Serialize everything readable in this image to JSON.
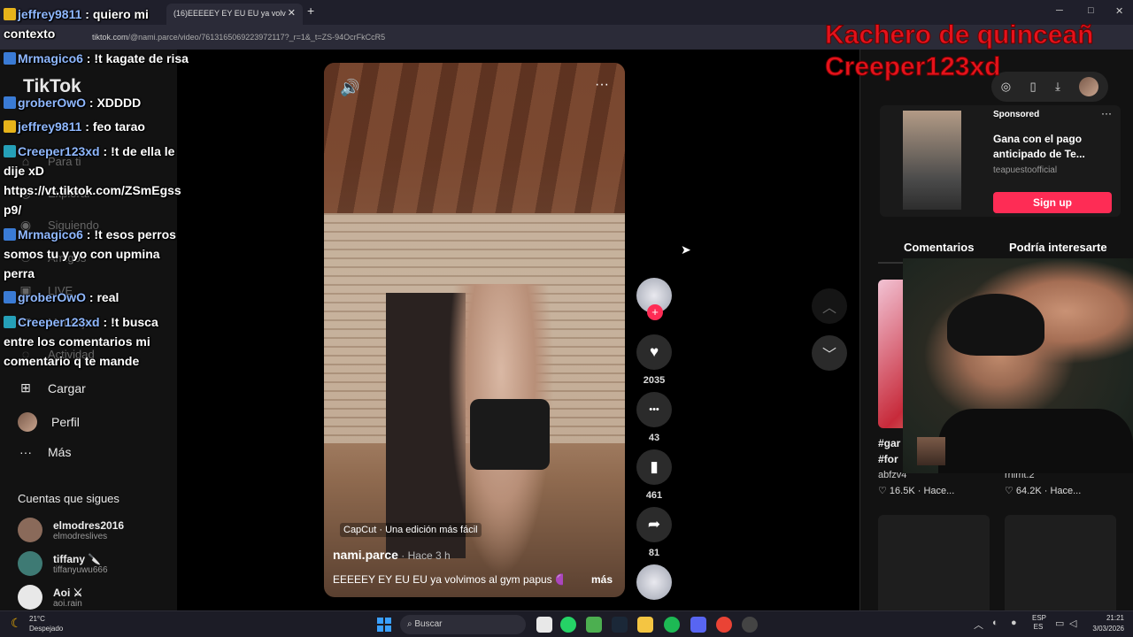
{
  "browser": {
    "tab_title": "(16)EEEEEY EY EU EU ya volv",
    "tab_close": "✕",
    "new_tab": "+",
    "url_host": "tiktok.com",
    "url_path": "/@nami.parce/video/7613165069223972117?_r=1&_t=ZS-94OcrFkCcR5",
    "win_min": "─",
    "win_max": "□",
    "win_close": "✕"
  },
  "overlay": {
    "line1": "Kachero de quinceañ",
    "line2": "Creeper123xd"
  },
  "chat": [
    {
      "user": "jeffrey9811",
      "text": " : quiero mi contexto",
      "badge": "gold"
    },
    {
      "user": "Mrmagico6",
      "text": " : !t kagate de risa",
      "badge": "blue"
    },
    {
      "user": "groberOwO",
      "text": " : XDDDD",
      "badge": "blue"
    },
    {
      "user": "jeffrey9811",
      "text": " : feo tarao",
      "badge": "gold"
    },
    {
      "user": "Creeper123xd",
      "text": " : !t de ella le dije xD https://vt.tiktok.com/ZSmEgss p9/",
      "badge": "teal"
    },
    {
      "user": "Mrmagico6",
      "text": " : !t esos perros somos tu y yo con upmina perra",
      "badge": "blue"
    },
    {
      "user": "groberOwO",
      "text": " : real",
      "badge": "blue"
    },
    {
      "user": "Creeper123xd",
      "text": " : !t busca entre los comentarios mi comentario q te mande",
      "badge": "teal"
    }
  ],
  "sidebar": {
    "logo": "TikTok",
    "dim_items": [
      "Para ti",
      "Explorar",
      "Siguiendo",
      "Amigos",
      "LIVE",
      "Mensajes",
      "Actividad"
    ],
    "items": [
      {
        "icon": "⊞",
        "label": "Cargar"
      },
      {
        "icon": "",
        "label": "Perfil"
      },
      {
        "icon": "···",
        "label": "Más"
      }
    ],
    "following_title": "Cuentas que sigues",
    "following": [
      {
        "name": "elmodres2016",
        "handle": "elmodreslives",
        "color": "#8a6a5a"
      },
      {
        "name": "tiffany 🔪",
        "handle": "tiffanyuwu666",
        "color": "#3e7a74"
      },
      {
        "name": "Aoi ⚔",
        "handle": "aoi.rain",
        "color": "#e8e8e8"
      }
    ]
  },
  "video": {
    "sound_icon": "🔊",
    "more_icon": "···",
    "capcut": "CapCut · Una edición más fácil",
    "author": "nami.parce",
    "posted": " · Hace 3 h",
    "caption": "EEEEEY EY EU EU ya volvimos al gym papus 🟣",
    "more": "más"
  },
  "actions": {
    "likes": "2035",
    "comments": "43",
    "saves": "461",
    "shares": "81",
    "like_icon": "♥",
    "comment_icon": "•••",
    "save_icon": "▮",
    "share_icon": "➦",
    "follow_plus": "+"
  },
  "nav": {
    "up": "︿",
    "down": "﹀"
  },
  "right_panel": {
    "icons": [
      "◎",
      "▯",
      "⤓",
      ""
    ],
    "ad": {
      "sponsored": "Sponsored",
      "dots": "···",
      "title": "Gana con el pago anticipado de Te...",
      "brand": "teapuestoofficial",
      "cta": "Sign up"
    },
    "tabs": [
      "Comentarios",
      "Podría interesarte"
    ],
    "tiles": [
      {
        "text": "#gar #for",
        "author": "abfzv4",
        "stats": "♡ 16.5K · Hace..."
      },
      {
        "text": "",
        "author": "rhimt.2",
        "stats": "♡ 64.2K · Hace..."
      }
    ]
  },
  "taskbar": {
    "temp": "21°C",
    "condition": "Despejado",
    "search": "Buscar",
    "lang": "ESP ES",
    "time": "21:21",
    "date": "3/03/2026",
    "apps": [
      {
        "name": "files-app-icon",
        "color": "#e8e8e8"
      },
      {
        "name": "whatsapp-icon",
        "color": "#25d366"
      },
      {
        "name": "minecraft-icon",
        "color": "#4caf50"
      },
      {
        "name": "steam-icon",
        "color": "#1b2838"
      },
      {
        "name": "folder-icon",
        "color": "#f4c542"
      },
      {
        "name": "spotify-icon",
        "color": "#1db954"
      },
      {
        "name": "discord-icon",
        "color": "#5865f2"
      },
      {
        "name": "chrome-icon",
        "color": "#ea4335"
      },
      {
        "name": "obs-icon",
        "color": "#444"
      }
    ]
  }
}
